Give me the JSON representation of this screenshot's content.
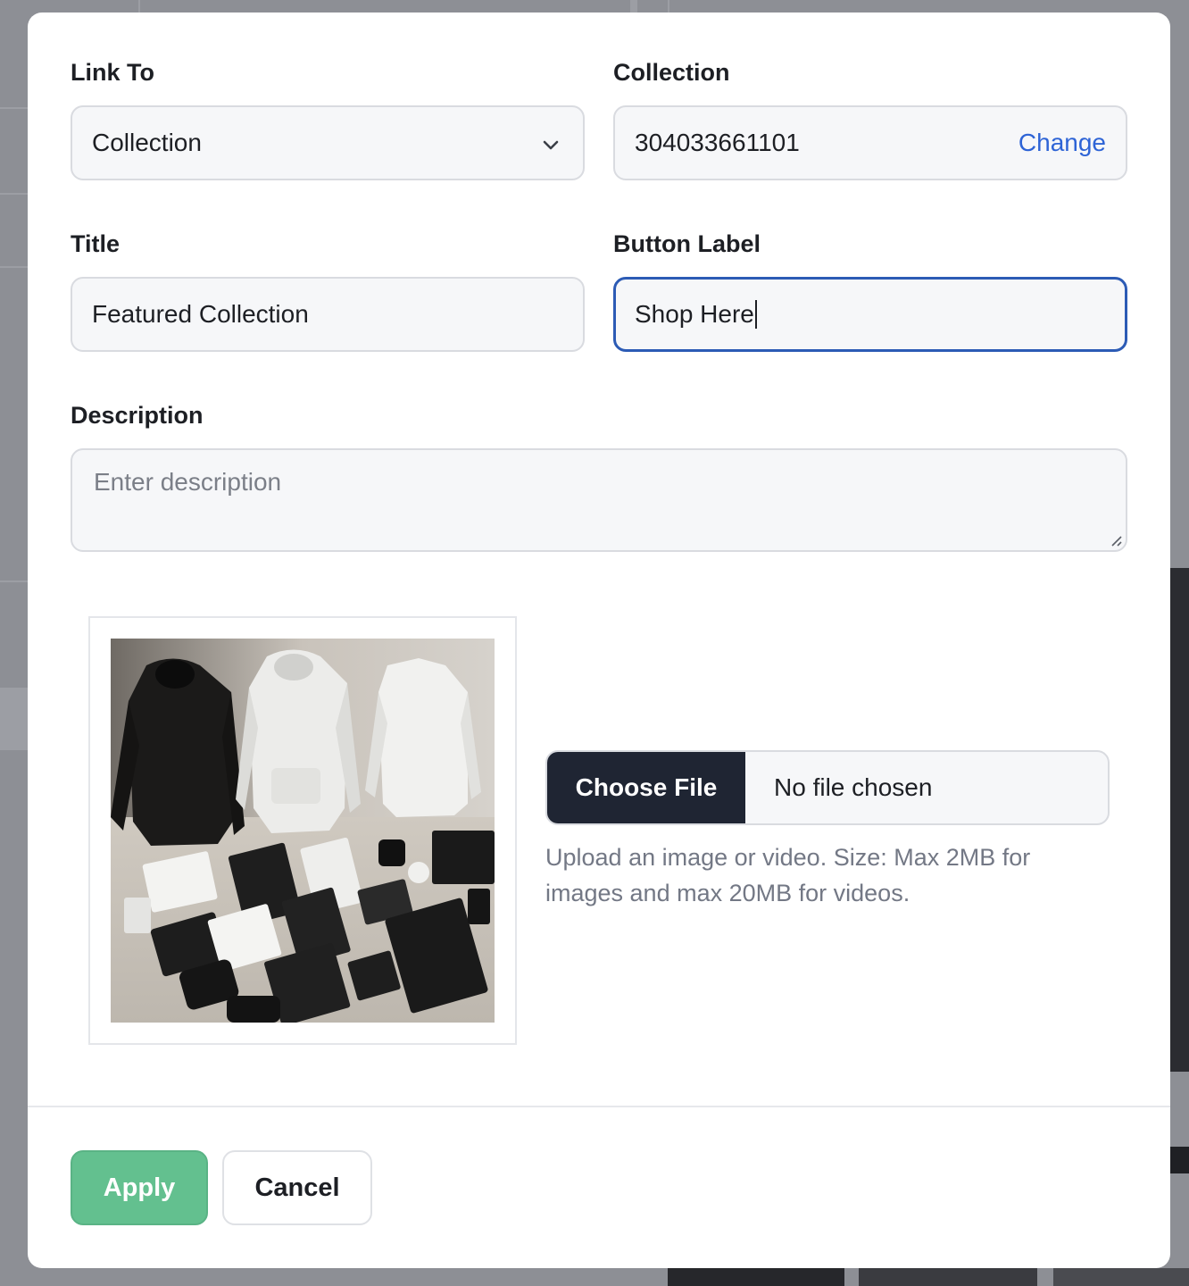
{
  "link_to": {
    "label": "Link To",
    "selected": "Collection",
    "icon": "chevron-down-icon"
  },
  "collection": {
    "label": "Collection",
    "value": "304033661101",
    "change_label": "Change"
  },
  "title_field": {
    "label": "Title",
    "value": "Featured Collection"
  },
  "button_label_field": {
    "label": "Button Label",
    "value": "Shop Here"
  },
  "description": {
    "label": "Description",
    "placeholder": "Enter description",
    "value": ""
  },
  "upload": {
    "choose_label": "Choose File",
    "file_name": "No file chosen",
    "help": "Upload an image or video. Size: Max 2MB for images and max 20MB for videos."
  },
  "footer": {
    "apply_label": "Apply",
    "cancel_label": "Cancel"
  },
  "colors": {
    "accent": "#2e64d6",
    "apply": "#63c08f",
    "focus": "#2c5bb5",
    "dark_button": "#1f2533"
  }
}
